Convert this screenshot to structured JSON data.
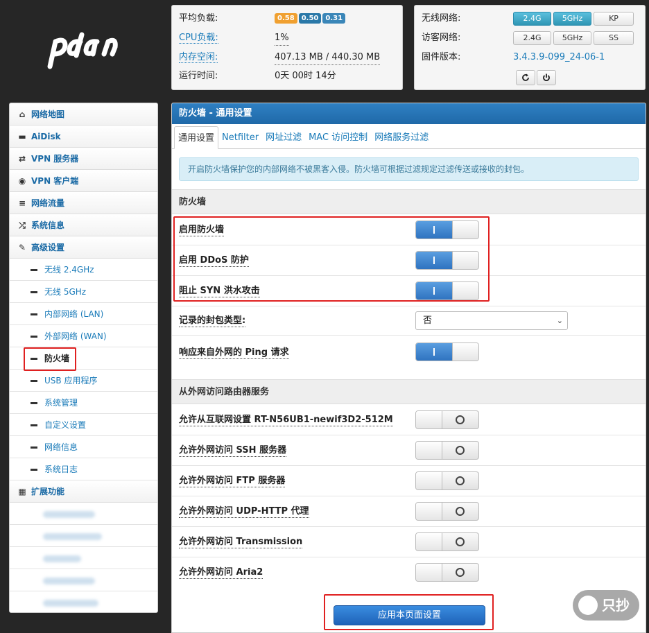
{
  "logo": {
    "text": "pdcn"
  },
  "system": {
    "load_label": "平均负载:",
    "load_values": [
      "0.58",
      "0.50",
      "0.31"
    ],
    "cpu_label": "CPU负载:",
    "cpu_value": "1%",
    "mem_label": "内存空闲:",
    "mem_value": "407.13 MB / 440.30 MB",
    "uptime_label": "运行时间:",
    "uptime_value": "0天 00时 14分"
  },
  "wireless": {
    "wifi_label": "无线网络:",
    "wifi_buttons": [
      "2.4G",
      "5GHz",
      "KP"
    ],
    "guest_label": "访客网络:",
    "guest_buttons": [
      "2.4G",
      "5GHz",
      "SS"
    ],
    "firmware_label": "固件版本:",
    "firmware_value": "3.4.3.9-099_24-06-1"
  },
  "sidebar": {
    "items": [
      {
        "label": "网络地图",
        "icon": "home-icon"
      },
      {
        "label": "AiDisk",
        "icon": "disk-icon"
      },
      {
        "label": "VPN 服务器",
        "icon": "transfer-icon"
      },
      {
        "label": "VPN 客户端",
        "icon": "globe-icon"
      },
      {
        "label": "网络流量",
        "icon": "list-icon"
      },
      {
        "label": "系统信息",
        "icon": "shuffle-icon"
      },
      {
        "label": "高级设置",
        "icon": "wrench-icon"
      }
    ],
    "sub_items": [
      "无线 2.4GHz",
      "无线 5GHz",
      "内部网络 (LAN)",
      "外部网络 (WAN)",
      "防火墙",
      "USB 应用程序",
      "系统管理",
      "自定义设置",
      "网络信息",
      "系统日志"
    ],
    "ext_label": "扩展功能"
  },
  "main": {
    "title": "防火墙 - 通用设置",
    "tabs": [
      "通用设置",
      "Netfilter",
      "网址过滤",
      "MAC 访问控制",
      "网络服务过滤"
    ],
    "alert": "开启防火墙保护您的内部网络不被黑客入侵。防火墙可根据过滤规定过滤传送或接收的封包。",
    "section1": "防火墙",
    "enable_fw": "启用防火墙",
    "enable_ddos": "启用 DDoS 防护",
    "block_syn": "阻止 SYN 洪水攻击",
    "log_type_label": "记录的封包类型:",
    "log_type_value": "否",
    "ping_label": "响应来自外网的 Ping 请求",
    "section2": "从外网访问路由器服务",
    "remote_web": "允许从互联网设置 RT-N56UB1-newif3D2-512M",
    "remote_ssh": "允许外网访问 SSH 服务器",
    "remote_ftp": "允许外网访问 FTP 服务器",
    "remote_udp": "允许外网访问 UDP-HTTP 代理",
    "remote_trans": "允许外网访问 Transmission",
    "remote_aria": "允许外网访问 Aria2",
    "apply": "应用本页面设置"
  },
  "watermark": "只抄",
  "colors": {
    "accent": "#1f69a8",
    "highlight": "#e02020",
    "toggle_on": "#2f73c0"
  }
}
